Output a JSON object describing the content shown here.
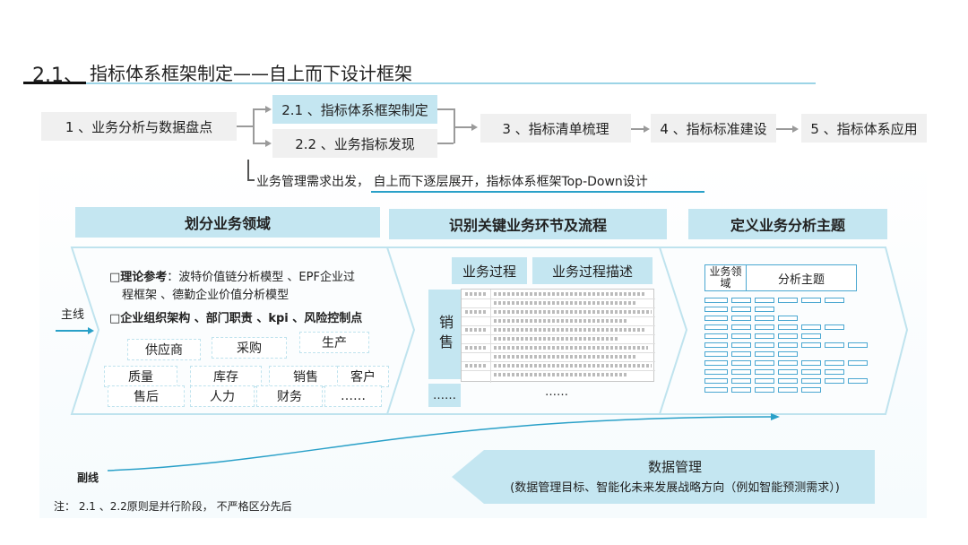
{
  "title": {
    "number": "2.1、",
    "text": "指标体系框架制定——自上而下设计框架"
  },
  "stages": {
    "s1": "1 、业务分析与数据盘点",
    "s21": "2.1 、指标体系框架制定",
    "s22": "2.2 、业务指标发现",
    "s3": "3 、指标清单梳理",
    "s4": "4 、指标标准建设",
    "s5": "5 、指标体系应用"
  },
  "top_note": "业务管理需求出发， 自上而下逐层展开，指标体系框架Top-Down设计",
  "sections": {
    "left_head": "划分业务领域",
    "mid_head": "识别关键业务环节及流程",
    "right_head": "定义业务分析主题"
  },
  "left": {
    "theory_label": "□理论参考",
    "theory_text": "：波特价值链分析模型 、EPF企业过",
    "theory_text2": "程框架 、德勤企业价值分析模型",
    "org_text": "□企业组织架构 、部门职责 、kpi 、风险控制点",
    "tags": [
      "供应商",
      "采购",
      "生产",
      "质量",
      "库存",
      "销售",
      "客户",
      "售后",
      "人力",
      "财务",
      "……"
    ]
  },
  "middle": {
    "col1": "业务过程",
    "col2": "业务过程描述",
    "row_label": "销售",
    "ellipsis1": "……",
    "ellipsis2": "……"
  },
  "right": {
    "col1": "业务领域",
    "col2": "分析主题"
  },
  "mainline_label": "主线",
  "subline_label": "副线",
  "data_mgmt": {
    "title": "数据管理",
    "subtitle": "(数据管理目标、智能化未来发展战略方向（例如智能预测需求）)"
  },
  "footnote": "注： 2.1 、2.2原则是并行阶段， 不严格区分先后"
}
